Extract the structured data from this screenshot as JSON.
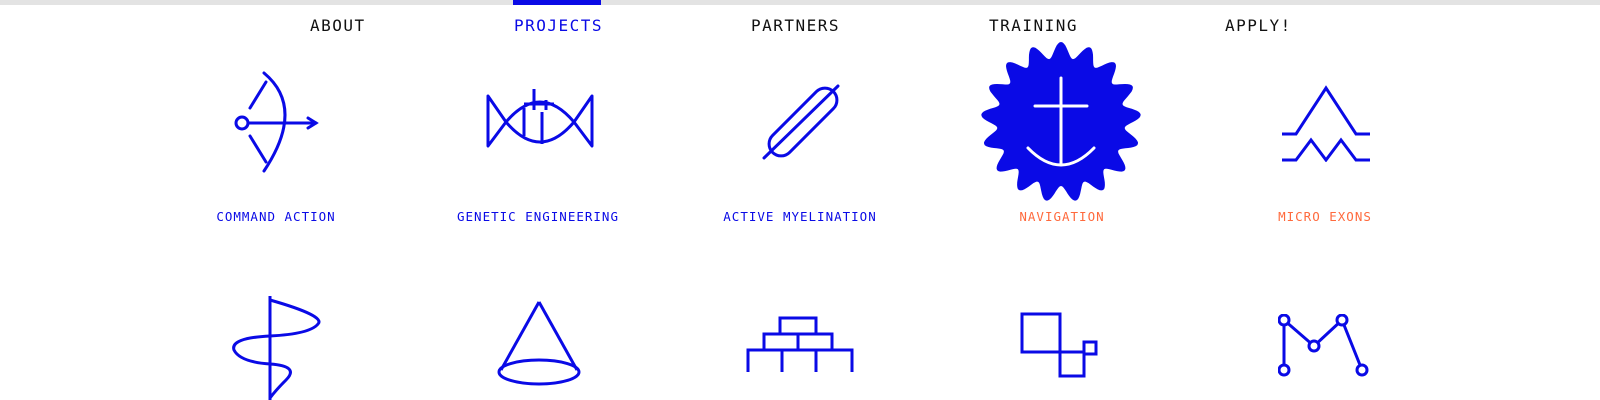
{
  "nav": {
    "items": [
      {
        "label": "ABOUT"
      },
      {
        "label": "PROJECTS",
        "active": true
      },
      {
        "label": "PARTNERS"
      },
      {
        "label": "TRAINING"
      },
      {
        "label": "APPLY!"
      }
    ]
  },
  "projects": {
    "row1": [
      {
        "label": "COMMAND ACTION",
        "icon": "bow-arrow-icon",
        "color": "#0a0ae6"
      },
      {
        "label": "GENETIC ENGINEERING",
        "icon": "fish-icon",
        "color": "#0a0ae6"
      },
      {
        "label": "ACTIVE MYELINATION",
        "icon": "capsule-icon",
        "color": "#0a0ae6"
      },
      {
        "label": "NAVIGATION",
        "icon": "anchor-seal-icon",
        "color": "#ff6a3d"
      },
      {
        "label": "MICRO EXONS",
        "icon": "mountains-icon",
        "color": "#ff6a3d"
      }
    ],
    "row2": [
      {
        "icon": "helix-wave-icon"
      },
      {
        "icon": "cone-icon"
      },
      {
        "icon": "brick-pyramid-icon"
      },
      {
        "icon": "squares-icon"
      },
      {
        "icon": "m-nodes-icon"
      }
    ]
  },
  "colors": {
    "accent": "#0a0ae6",
    "highlight": "#ff6a3d",
    "text": "#111111",
    "bar": "#e3e3e3"
  }
}
